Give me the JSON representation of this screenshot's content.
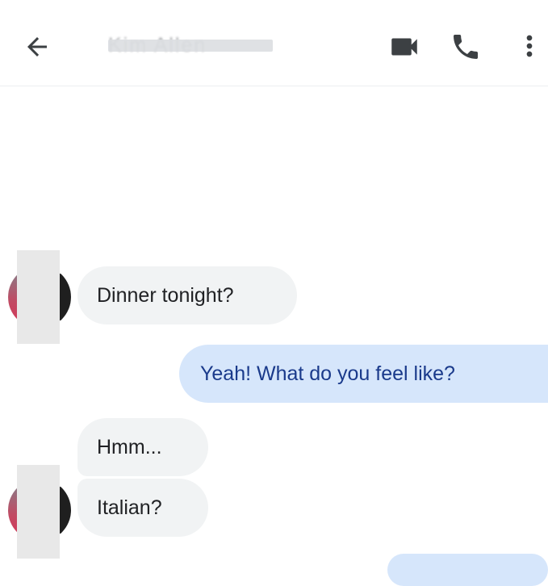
{
  "header": {
    "contact_name": "Kim Allen",
    "back_icon": "arrow-back-icon",
    "video_icon": "videocam-icon",
    "call_icon": "phone-icon",
    "more_icon": "more-vert-icon"
  },
  "messages": [
    {
      "direction": "incoming",
      "text": "Dinner tonight?"
    },
    {
      "direction": "outgoing",
      "text": "Yeah! What do you feel like?"
    },
    {
      "direction": "incoming",
      "text": "Hmm..."
    },
    {
      "direction": "incoming",
      "text": "Italian?"
    },
    {
      "direction": "outgoing",
      "text": ""
    }
  ],
  "colors": {
    "incoming_bubble": "#f1f3f4",
    "outgoing_bubble": "#d6e6fb",
    "outgoing_text": "#1a3a8b",
    "icon": "#3c4043"
  }
}
